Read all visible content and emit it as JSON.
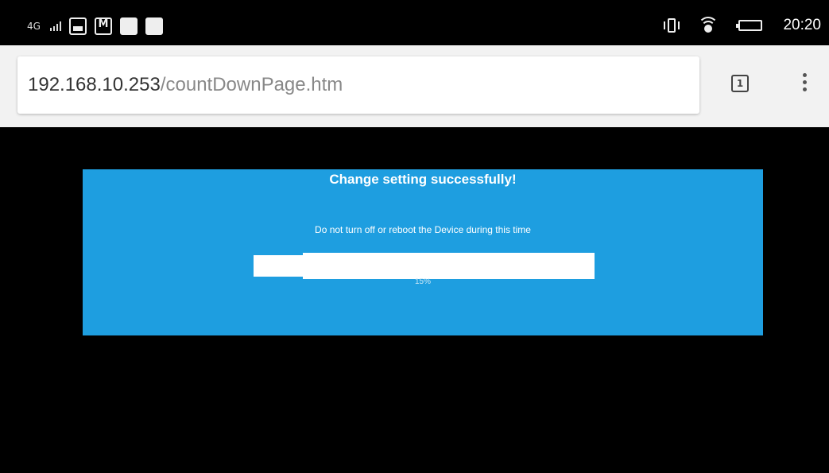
{
  "status_bar": {
    "network": "4G",
    "time": "20:20",
    "icons": [
      "signal-icon",
      "gallery-notification-icon",
      "mail-notification-icon",
      "blank-notification-icon",
      "vibrate-icon",
      "wifi-icon",
      "battery-icon"
    ]
  },
  "browser": {
    "url_host": "192.168.10.253",
    "url_path": "/countDownPage.htm",
    "tab_count": "1"
  },
  "panel": {
    "title": "Change setting successfully!",
    "message": "Do not turn off or reboot the Device during this time",
    "progress_label": "15%",
    "progress_value": 0.15,
    "color": "#1e9ee0"
  }
}
